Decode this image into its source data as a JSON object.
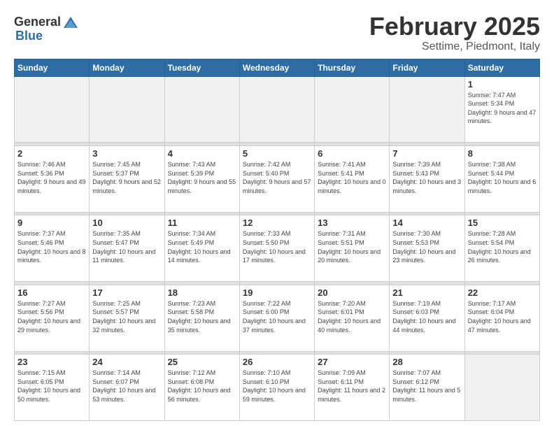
{
  "logo": {
    "general": "General",
    "blue": "Blue"
  },
  "header": {
    "month": "February 2025",
    "location": "Settime, Piedmont, Italy"
  },
  "weekdays": [
    "Sunday",
    "Monday",
    "Tuesday",
    "Wednesday",
    "Thursday",
    "Friday",
    "Saturday"
  ],
  "weeks": [
    [
      {
        "day": "",
        "empty": true
      },
      {
        "day": "",
        "empty": true
      },
      {
        "day": "",
        "empty": true
      },
      {
        "day": "",
        "empty": true
      },
      {
        "day": "",
        "empty": true
      },
      {
        "day": "",
        "empty": true
      },
      {
        "day": "1",
        "sunrise": "Sunrise: 7:47 AM",
        "sunset": "Sunset: 5:34 PM",
        "daylight": "Daylight: 9 hours and 47 minutes."
      }
    ],
    [
      {
        "day": "2",
        "sunrise": "Sunrise: 7:46 AM",
        "sunset": "Sunset: 5:36 PM",
        "daylight": "Daylight: 9 hours and 49 minutes."
      },
      {
        "day": "3",
        "sunrise": "Sunrise: 7:45 AM",
        "sunset": "Sunset: 5:37 PM",
        "daylight": "Daylight: 9 hours and 52 minutes."
      },
      {
        "day": "4",
        "sunrise": "Sunrise: 7:43 AM",
        "sunset": "Sunset: 5:39 PM",
        "daylight": "Daylight: 9 hours and 55 minutes."
      },
      {
        "day": "5",
        "sunrise": "Sunrise: 7:42 AM",
        "sunset": "Sunset: 5:40 PM",
        "daylight": "Daylight: 9 hours and 57 minutes."
      },
      {
        "day": "6",
        "sunrise": "Sunrise: 7:41 AM",
        "sunset": "Sunset: 5:41 PM",
        "daylight": "Daylight: 10 hours and 0 minutes."
      },
      {
        "day": "7",
        "sunrise": "Sunrise: 7:39 AM",
        "sunset": "Sunset: 5:43 PM",
        "daylight": "Daylight: 10 hours and 3 minutes."
      },
      {
        "day": "8",
        "sunrise": "Sunrise: 7:38 AM",
        "sunset": "Sunset: 5:44 PM",
        "daylight": "Daylight: 10 hours and 6 minutes."
      }
    ],
    [
      {
        "day": "9",
        "sunrise": "Sunrise: 7:37 AM",
        "sunset": "Sunset: 5:46 PM",
        "daylight": "Daylight: 10 hours and 8 minutes."
      },
      {
        "day": "10",
        "sunrise": "Sunrise: 7:35 AM",
        "sunset": "Sunset: 5:47 PM",
        "daylight": "Daylight: 10 hours and 11 minutes."
      },
      {
        "day": "11",
        "sunrise": "Sunrise: 7:34 AM",
        "sunset": "Sunset: 5:49 PM",
        "daylight": "Daylight: 10 hours and 14 minutes."
      },
      {
        "day": "12",
        "sunrise": "Sunrise: 7:33 AM",
        "sunset": "Sunset: 5:50 PM",
        "daylight": "Daylight: 10 hours and 17 minutes."
      },
      {
        "day": "13",
        "sunrise": "Sunrise: 7:31 AM",
        "sunset": "Sunset: 5:51 PM",
        "daylight": "Daylight: 10 hours and 20 minutes."
      },
      {
        "day": "14",
        "sunrise": "Sunrise: 7:30 AM",
        "sunset": "Sunset: 5:53 PM",
        "daylight": "Daylight: 10 hours and 23 minutes."
      },
      {
        "day": "15",
        "sunrise": "Sunrise: 7:28 AM",
        "sunset": "Sunset: 5:54 PM",
        "daylight": "Daylight: 10 hours and 26 minutes."
      }
    ],
    [
      {
        "day": "16",
        "sunrise": "Sunrise: 7:27 AM",
        "sunset": "Sunset: 5:56 PM",
        "daylight": "Daylight: 10 hours and 29 minutes."
      },
      {
        "day": "17",
        "sunrise": "Sunrise: 7:25 AM",
        "sunset": "Sunset: 5:57 PM",
        "daylight": "Daylight: 10 hours and 32 minutes."
      },
      {
        "day": "18",
        "sunrise": "Sunrise: 7:23 AM",
        "sunset": "Sunset: 5:58 PM",
        "daylight": "Daylight: 10 hours and 35 minutes."
      },
      {
        "day": "19",
        "sunrise": "Sunrise: 7:22 AM",
        "sunset": "Sunset: 6:00 PM",
        "daylight": "Daylight: 10 hours and 37 minutes."
      },
      {
        "day": "20",
        "sunrise": "Sunrise: 7:20 AM",
        "sunset": "Sunset: 6:01 PM",
        "daylight": "Daylight: 10 hours and 40 minutes."
      },
      {
        "day": "21",
        "sunrise": "Sunrise: 7:19 AM",
        "sunset": "Sunset: 6:03 PM",
        "daylight": "Daylight: 10 hours and 44 minutes."
      },
      {
        "day": "22",
        "sunrise": "Sunrise: 7:17 AM",
        "sunset": "Sunset: 6:04 PM",
        "daylight": "Daylight: 10 hours and 47 minutes."
      }
    ],
    [
      {
        "day": "23",
        "sunrise": "Sunrise: 7:15 AM",
        "sunset": "Sunset: 6:05 PM",
        "daylight": "Daylight: 10 hours and 50 minutes."
      },
      {
        "day": "24",
        "sunrise": "Sunrise: 7:14 AM",
        "sunset": "Sunset: 6:07 PM",
        "daylight": "Daylight: 10 hours and 53 minutes."
      },
      {
        "day": "25",
        "sunrise": "Sunrise: 7:12 AM",
        "sunset": "Sunset: 6:08 PM",
        "daylight": "Daylight: 10 hours and 56 minutes."
      },
      {
        "day": "26",
        "sunrise": "Sunrise: 7:10 AM",
        "sunset": "Sunset: 6:10 PM",
        "daylight": "Daylight: 10 hours and 59 minutes."
      },
      {
        "day": "27",
        "sunrise": "Sunrise: 7:09 AM",
        "sunset": "Sunset: 6:11 PM",
        "daylight": "Daylight: 11 hours and 2 minutes."
      },
      {
        "day": "28",
        "sunrise": "Sunrise: 7:07 AM",
        "sunset": "Sunset: 6:12 PM",
        "daylight": "Daylight: 11 hours and 5 minutes."
      },
      {
        "day": "",
        "empty": true
      }
    ]
  ]
}
